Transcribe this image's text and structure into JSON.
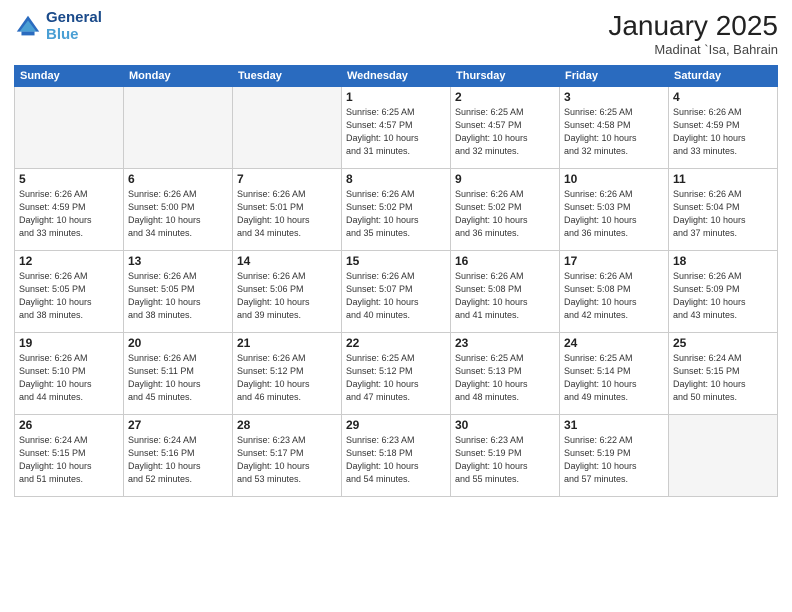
{
  "logo": {
    "line1": "General",
    "line2": "Blue"
  },
  "header": {
    "month": "January 2025",
    "location": "Madinat `Isa, Bahrain"
  },
  "weekdays": [
    "Sunday",
    "Monday",
    "Tuesday",
    "Wednesday",
    "Thursday",
    "Friday",
    "Saturday"
  ],
  "weeks": [
    [
      {
        "day": "",
        "info": ""
      },
      {
        "day": "",
        "info": ""
      },
      {
        "day": "",
        "info": ""
      },
      {
        "day": "1",
        "info": "Sunrise: 6:25 AM\nSunset: 4:57 PM\nDaylight: 10 hours\nand 31 minutes."
      },
      {
        "day": "2",
        "info": "Sunrise: 6:25 AM\nSunset: 4:57 PM\nDaylight: 10 hours\nand 32 minutes."
      },
      {
        "day": "3",
        "info": "Sunrise: 6:25 AM\nSunset: 4:58 PM\nDaylight: 10 hours\nand 32 minutes."
      },
      {
        "day": "4",
        "info": "Sunrise: 6:26 AM\nSunset: 4:59 PM\nDaylight: 10 hours\nand 33 minutes."
      }
    ],
    [
      {
        "day": "5",
        "info": "Sunrise: 6:26 AM\nSunset: 4:59 PM\nDaylight: 10 hours\nand 33 minutes."
      },
      {
        "day": "6",
        "info": "Sunrise: 6:26 AM\nSunset: 5:00 PM\nDaylight: 10 hours\nand 34 minutes."
      },
      {
        "day": "7",
        "info": "Sunrise: 6:26 AM\nSunset: 5:01 PM\nDaylight: 10 hours\nand 34 minutes."
      },
      {
        "day": "8",
        "info": "Sunrise: 6:26 AM\nSunset: 5:02 PM\nDaylight: 10 hours\nand 35 minutes."
      },
      {
        "day": "9",
        "info": "Sunrise: 6:26 AM\nSunset: 5:02 PM\nDaylight: 10 hours\nand 36 minutes."
      },
      {
        "day": "10",
        "info": "Sunrise: 6:26 AM\nSunset: 5:03 PM\nDaylight: 10 hours\nand 36 minutes."
      },
      {
        "day": "11",
        "info": "Sunrise: 6:26 AM\nSunset: 5:04 PM\nDaylight: 10 hours\nand 37 minutes."
      }
    ],
    [
      {
        "day": "12",
        "info": "Sunrise: 6:26 AM\nSunset: 5:05 PM\nDaylight: 10 hours\nand 38 minutes."
      },
      {
        "day": "13",
        "info": "Sunrise: 6:26 AM\nSunset: 5:05 PM\nDaylight: 10 hours\nand 38 minutes."
      },
      {
        "day": "14",
        "info": "Sunrise: 6:26 AM\nSunset: 5:06 PM\nDaylight: 10 hours\nand 39 minutes."
      },
      {
        "day": "15",
        "info": "Sunrise: 6:26 AM\nSunset: 5:07 PM\nDaylight: 10 hours\nand 40 minutes."
      },
      {
        "day": "16",
        "info": "Sunrise: 6:26 AM\nSunset: 5:08 PM\nDaylight: 10 hours\nand 41 minutes."
      },
      {
        "day": "17",
        "info": "Sunrise: 6:26 AM\nSunset: 5:08 PM\nDaylight: 10 hours\nand 42 minutes."
      },
      {
        "day": "18",
        "info": "Sunrise: 6:26 AM\nSunset: 5:09 PM\nDaylight: 10 hours\nand 43 minutes."
      }
    ],
    [
      {
        "day": "19",
        "info": "Sunrise: 6:26 AM\nSunset: 5:10 PM\nDaylight: 10 hours\nand 44 minutes."
      },
      {
        "day": "20",
        "info": "Sunrise: 6:26 AM\nSunset: 5:11 PM\nDaylight: 10 hours\nand 45 minutes."
      },
      {
        "day": "21",
        "info": "Sunrise: 6:26 AM\nSunset: 5:12 PM\nDaylight: 10 hours\nand 46 minutes."
      },
      {
        "day": "22",
        "info": "Sunrise: 6:25 AM\nSunset: 5:12 PM\nDaylight: 10 hours\nand 47 minutes."
      },
      {
        "day": "23",
        "info": "Sunrise: 6:25 AM\nSunset: 5:13 PM\nDaylight: 10 hours\nand 48 minutes."
      },
      {
        "day": "24",
        "info": "Sunrise: 6:25 AM\nSunset: 5:14 PM\nDaylight: 10 hours\nand 49 minutes."
      },
      {
        "day": "25",
        "info": "Sunrise: 6:24 AM\nSunset: 5:15 PM\nDaylight: 10 hours\nand 50 minutes."
      }
    ],
    [
      {
        "day": "26",
        "info": "Sunrise: 6:24 AM\nSunset: 5:15 PM\nDaylight: 10 hours\nand 51 minutes."
      },
      {
        "day": "27",
        "info": "Sunrise: 6:24 AM\nSunset: 5:16 PM\nDaylight: 10 hours\nand 52 minutes."
      },
      {
        "day": "28",
        "info": "Sunrise: 6:23 AM\nSunset: 5:17 PM\nDaylight: 10 hours\nand 53 minutes."
      },
      {
        "day": "29",
        "info": "Sunrise: 6:23 AM\nSunset: 5:18 PM\nDaylight: 10 hours\nand 54 minutes."
      },
      {
        "day": "30",
        "info": "Sunrise: 6:23 AM\nSunset: 5:19 PM\nDaylight: 10 hours\nand 55 minutes."
      },
      {
        "day": "31",
        "info": "Sunrise: 6:22 AM\nSunset: 5:19 PM\nDaylight: 10 hours\nand 57 minutes."
      },
      {
        "day": "",
        "info": ""
      }
    ]
  ]
}
